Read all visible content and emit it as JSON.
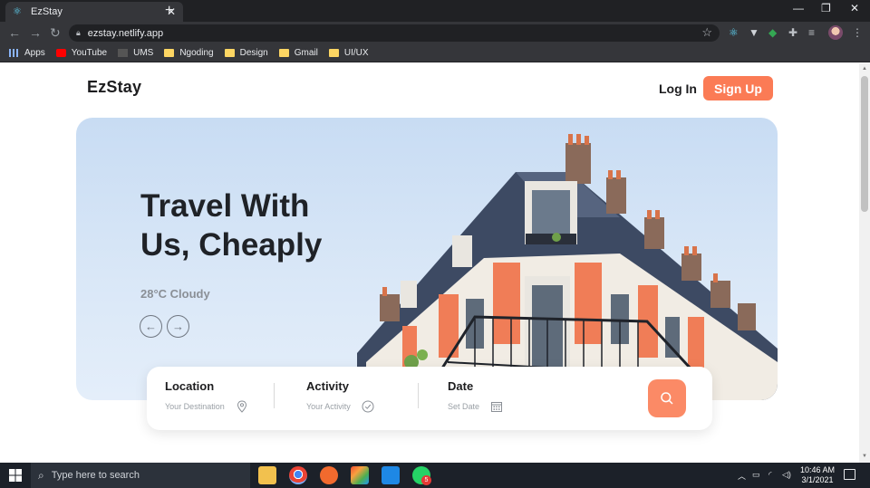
{
  "browser": {
    "tab_title": "EzStay",
    "url": "ezstay.netlify.app",
    "bookmarks": [
      {
        "label": "Apps",
        "icon": "apps-icon"
      },
      {
        "label": "YouTube",
        "icon": "youtube-icon"
      },
      {
        "label": "UMS",
        "icon": "ums-icon"
      },
      {
        "label": "Ngoding",
        "icon": "folder-icon"
      },
      {
        "label": "Design",
        "icon": "folder-icon"
      },
      {
        "label": "Gmail",
        "icon": "folder-icon"
      },
      {
        "label": "UI/UX",
        "icon": "folder-icon"
      }
    ]
  },
  "site": {
    "logo": "EzStay",
    "login_label": "Log In",
    "signup_label": "Sign Up",
    "hero_title_line1": "Travel With",
    "hero_title_line2": "Us, Cheaply",
    "weather": "28°C Cloudy",
    "search": {
      "location_label": "Location",
      "location_placeholder": "Your Destination",
      "activity_label": "Activity",
      "activity_placeholder": "Your Activity",
      "date_label": "Date",
      "date_placeholder": "Set Date"
    },
    "colors": {
      "accent": "#fb7b55",
      "search_button": "#fb8a66",
      "text": "#1d1d1f"
    }
  },
  "taskbar": {
    "search_placeholder": "Type here to search",
    "time": "10:46 AM",
    "date": "3/1/2021",
    "whatsapp_badge": "5"
  }
}
